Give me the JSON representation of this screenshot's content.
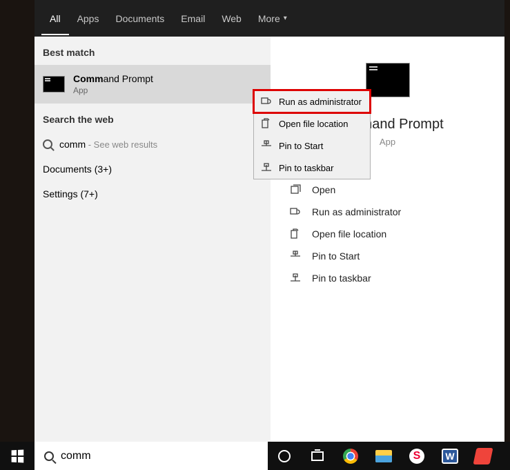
{
  "tabs": {
    "all": "All",
    "apps": "Apps",
    "documents": "Documents",
    "email": "Email",
    "web": "Web",
    "more": "More"
  },
  "sections": {
    "best_match": "Best match",
    "search_web": "Search the web"
  },
  "best_match": {
    "title_bold": "Comm",
    "title_rest": "and Prompt",
    "subtitle": "App"
  },
  "web_result": {
    "query": "comm",
    "suffix": " - See web results"
  },
  "groups": {
    "documents": "Documents (3+)",
    "settings": "Settings (7+)"
  },
  "context_menu": {
    "run_admin": "Run as administrator",
    "open_loc": "Open file location",
    "pin_start": "Pin to Start",
    "pin_taskbar": "Pin to taskbar"
  },
  "preview": {
    "title": "Command Prompt",
    "subtitle": "App",
    "actions": {
      "open": "Open",
      "run_admin": "Run as administrator",
      "open_loc": "Open file location",
      "pin_start": "Pin to Start",
      "pin_taskbar": "Pin to taskbar"
    }
  },
  "search": {
    "value": "comm"
  }
}
